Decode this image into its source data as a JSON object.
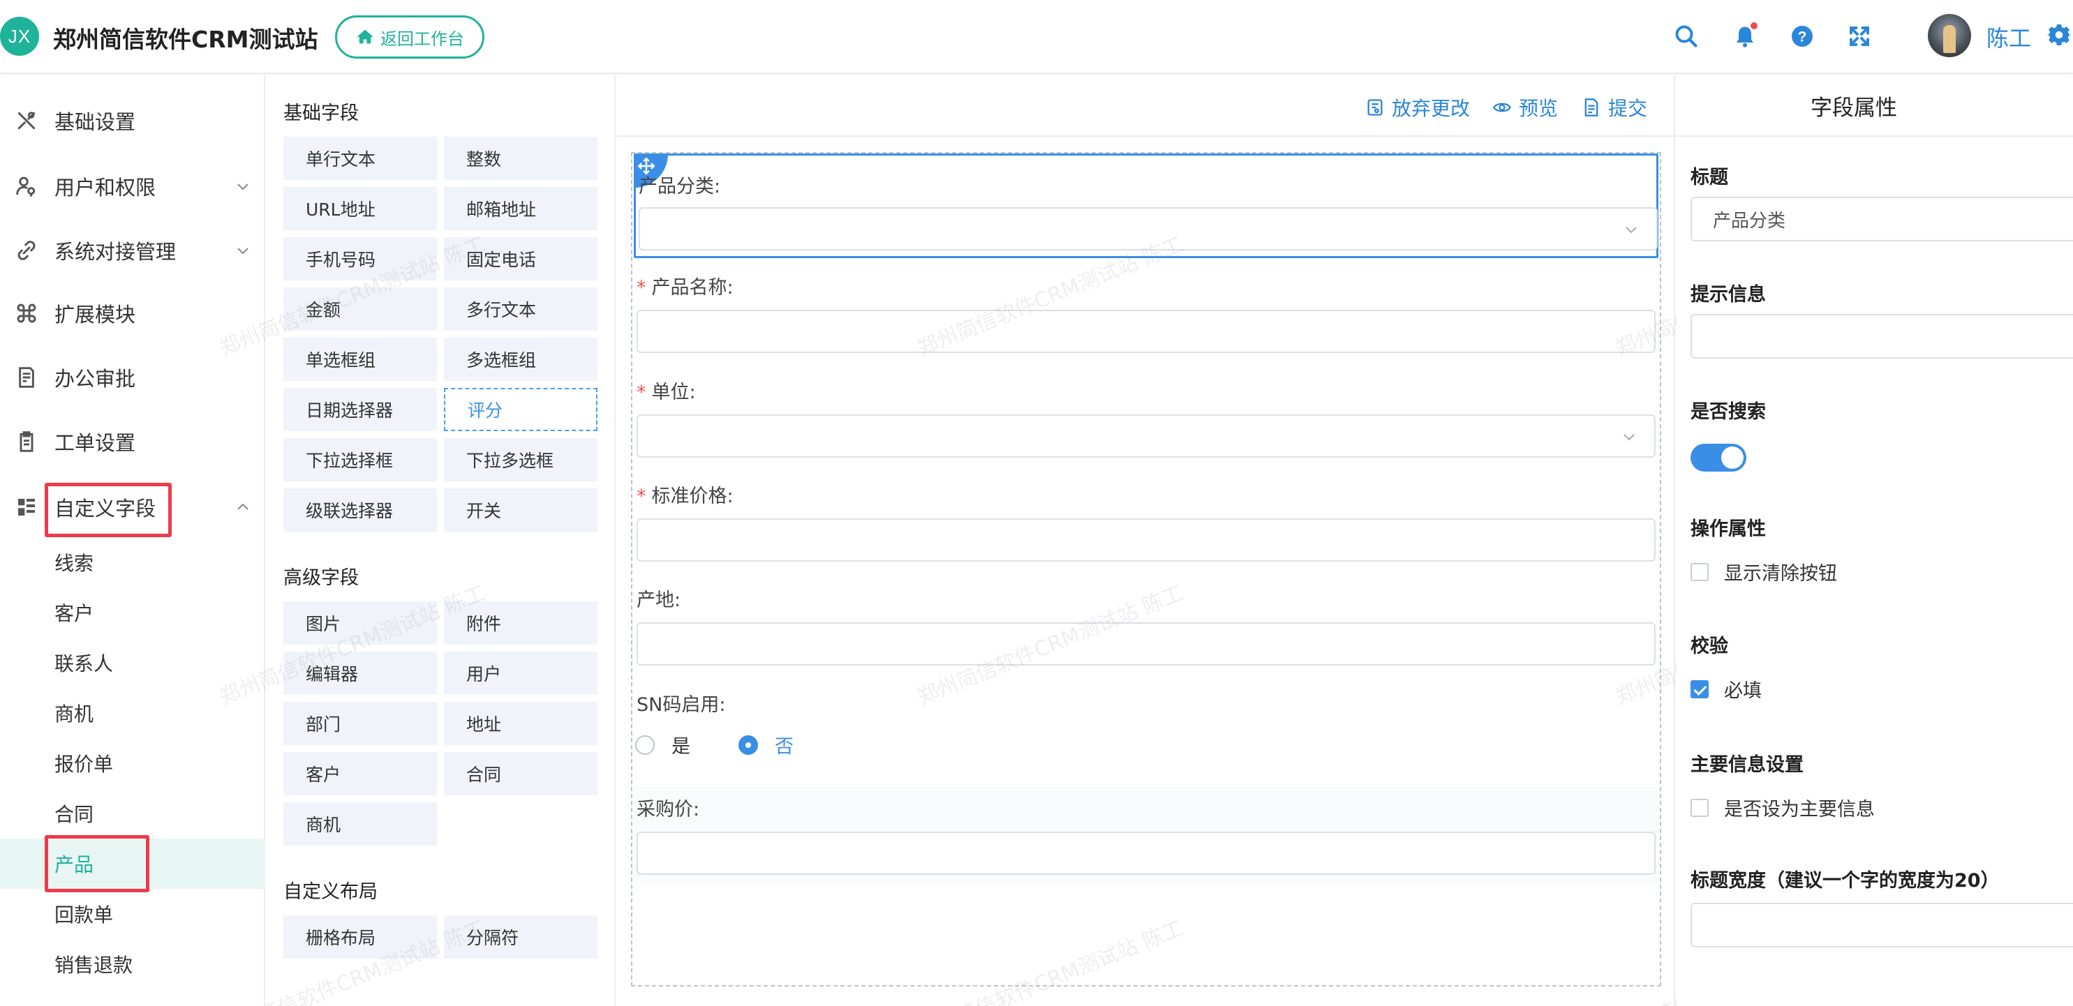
{
  "header": {
    "logo_text": "JX",
    "app_title": "郑州简信软件CRM测试站",
    "back_label": "返回工作台",
    "user_name": "陈工",
    "accent": "#1fb39a",
    "link_color": "#2a86d8",
    "icons": [
      "search-icon",
      "bell-icon",
      "help-icon",
      "fullscreen-icon",
      "gear-icon"
    ]
  },
  "sidebar": {
    "items": [
      {
        "label": "基础设置",
        "icon": "tools-icon"
      },
      {
        "label": "用户和权限",
        "icon": "user-key-icon",
        "expandable": true
      },
      {
        "label": "系统对接管理",
        "icon": "link-icon",
        "expandable": true
      },
      {
        "label": "扩展模块",
        "icon": "command-icon"
      },
      {
        "label": "办公审批",
        "icon": "approval-icon"
      },
      {
        "label": "工单设置",
        "icon": "clipboard-icon"
      },
      {
        "label": "自定义字段",
        "icon": "custom-field-icon",
        "expanded": true
      }
    ],
    "sub_items": [
      "线索",
      "客户",
      "联系人",
      "商机",
      "报价单",
      "合同",
      "产品",
      "回款单",
      "销售退款"
    ],
    "active_sub": "产品"
  },
  "palette": {
    "basic_title": "基础字段",
    "basic": [
      "单行文本",
      "整数",
      "URL地址",
      "邮箱地址",
      "手机号码",
      "固定电话",
      "金额",
      "多行文本",
      "单选框组",
      "多选框组",
      "日期选择器",
      "评分",
      "下拉选择框",
      "下拉多选框",
      "级联选择器",
      "开关"
    ],
    "selected": "评分",
    "advanced_title": "高级字段",
    "advanced": [
      "图片",
      "附件",
      "编辑器",
      "用户",
      "部门",
      "地址",
      "客户",
      "合同",
      "商机"
    ],
    "layout_title": "自定义布局",
    "layout": [
      "栅格布局",
      "分隔符"
    ]
  },
  "toolbar": {
    "discard_label": "放弃更改",
    "preview_label": "预览",
    "submit_label": "提交"
  },
  "form": {
    "fields": [
      {
        "label": "产品分类:",
        "required": false,
        "type": "select"
      },
      {
        "label": "产品名称:",
        "required": true,
        "type": "text"
      },
      {
        "label": "单位:",
        "required": true,
        "type": "select"
      },
      {
        "label": "标准价格:",
        "required": true,
        "type": "text"
      },
      {
        "label": "产地:",
        "required": false,
        "type": "text"
      },
      {
        "label": "SN码启用:",
        "required": false,
        "type": "radio"
      },
      {
        "label": "采购价:",
        "required": false,
        "type": "text"
      }
    ],
    "radio_options": [
      "是",
      "否"
    ],
    "radio_selected": "否",
    "required_mark": "*"
  },
  "watermark_text": "郑州简信软件CRM测试站 陈工",
  "props": {
    "title": "字段属性",
    "label_title": "标题",
    "title_value": "产品分类",
    "label_hint": "提示信息",
    "hint_value": "",
    "label_search": "是否搜索",
    "search_on": true,
    "label_ops": "操作属性",
    "clear_btn_label": "显示清除按钮",
    "clear_btn_checked": false,
    "label_validate": "校验",
    "required_label": "必填",
    "required_checked": true,
    "label_main": "主要信息设置",
    "main_label": "是否设为主要信息",
    "main_checked": false,
    "label_width": "标题宽度（建议一个字的宽度为20）",
    "width_value": ""
  }
}
